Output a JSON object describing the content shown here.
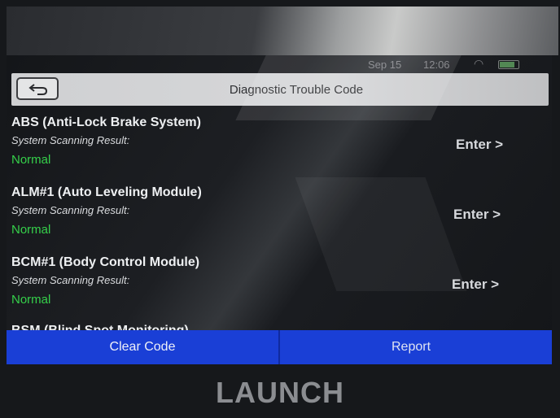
{
  "status_bar": {
    "date": "Sep 15",
    "time": "12:06"
  },
  "header": {
    "title": "Diagnostic Trouble Code",
    "back_icon": "back-arrow-icon"
  },
  "systems": [
    {
      "name": "ABS (Anti-Lock Brake System)",
      "result_label": "System Scanning Result:",
      "result": "Normal",
      "action": "Enter >"
    },
    {
      "name": "ALM#1 (Auto Leveling Module)",
      "result_label": "System Scanning Result:",
      "result": "Normal",
      "action": "Enter >"
    },
    {
      "name": "BCM#1 (Body Control Module)",
      "result_label": "System Scanning Result:",
      "result": "Normal",
      "action": "Enter >"
    },
    {
      "name": "BSM (Blind Spot Monitoring)"
    }
  ],
  "footer": {
    "clear_label": "Clear Code",
    "report_label": "Report"
  },
  "brand": "LAUNCH",
  "colors": {
    "button_bar": "#1a3fd6",
    "normal_status": "#35d04a"
  }
}
